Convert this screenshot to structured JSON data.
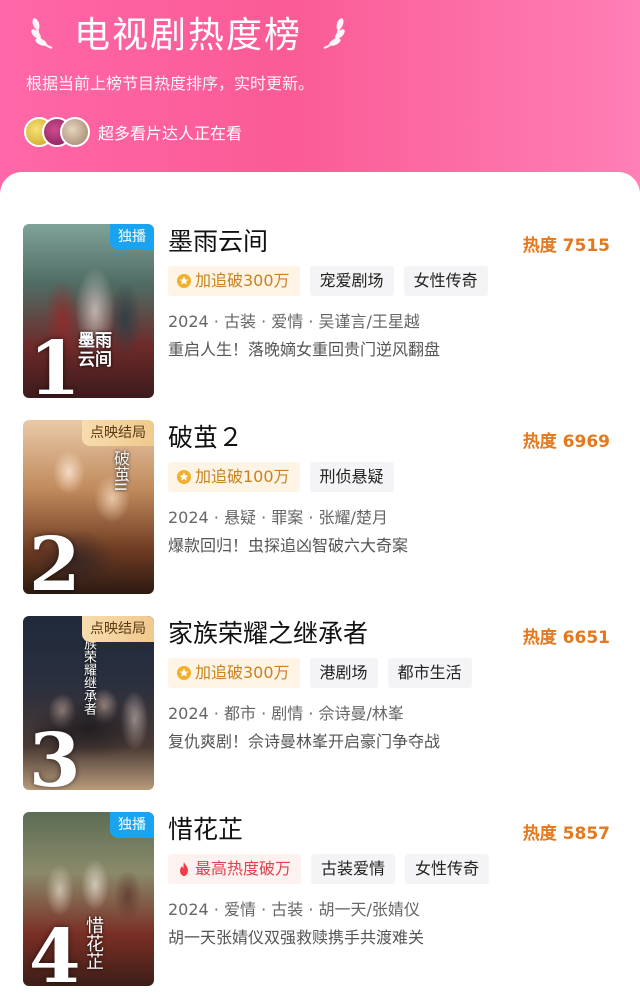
{
  "header": {
    "title": "电视剧热度榜",
    "subtitle": "根据当前上榜节目热度排序，实时更新。",
    "viewers_text": "超多看片达人正在看"
  },
  "colors": {
    "header_gradient_start": "#ff67a8",
    "header_gradient_end": "#ff7fb6",
    "heat": "#e4781d",
    "exclusive_badge": "#1aa4f0",
    "finished_badge": "#f0c98d"
  },
  "items": [
    {
      "rank": "1",
      "badge": "独播",
      "badge_style": "blue",
      "title": "墨雨云间",
      "heat": "热度 7515",
      "highlight_tag": "加追破300万",
      "highlight_icon": "star-coin-icon",
      "tags": [
        "宠爱剧场",
        "女性传奇"
      ],
      "meta": "2024 · 古装 · 爱情 · 吴谨言/王星越",
      "desc": "重启人生！落晚嫡女重回贵门逆风翻盘",
      "poster_caption": "墨雨云间"
    },
    {
      "rank": "2",
      "badge": "点映结局",
      "badge_style": "gold",
      "title": "破茧２",
      "heat": "热度 6969",
      "highlight_tag": "加追破100万",
      "highlight_icon": "star-coin-icon",
      "tags": [
        "刑侦悬疑"
      ],
      "meta": "2024 · 悬疑 · 罪案 · 张耀/楚月",
      "desc": "爆款回归！虫探追凶智破六大奇案",
      "poster_caption": "破茧II"
    },
    {
      "rank": "3",
      "badge": "点映结局",
      "badge_style": "gold",
      "title": "家族荣耀之继承者",
      "heat": "热度 6651",
      "highlight_tag": "加追破300万",
      "highlight_icon": "star-coin-icon",
      "tags": [
        "港剧场",
        "都市生活"
      ],
      "meta": "2024 · 都市 · 剧情 · 佘诗曼/林峯",
      "desc": "复仇爽剧！佘诗曼林峯开启豪门争夺战",
      "poster_caption": "家族荣耀继承者"
    },
    {
      "rank": "4",
      "badge": "独播",
      "badge_style": "blue",
      "title": "惜花芷",
      "heat": "热度 5857",
      "highlight_tag": "最高热度破万",
      "highlight_icon": "flame-icon",
      "tags": [
        "古装爱情",
        "女性传奇"
      ],
      "meta": "2024 · 爱情 · 古装 · 胡一天/张婧仪",
      "desc": "胡一天张婧仪双强救赎携手共渡难关",
      "poster_caption": "惜花芷"
    }
  ]
}
